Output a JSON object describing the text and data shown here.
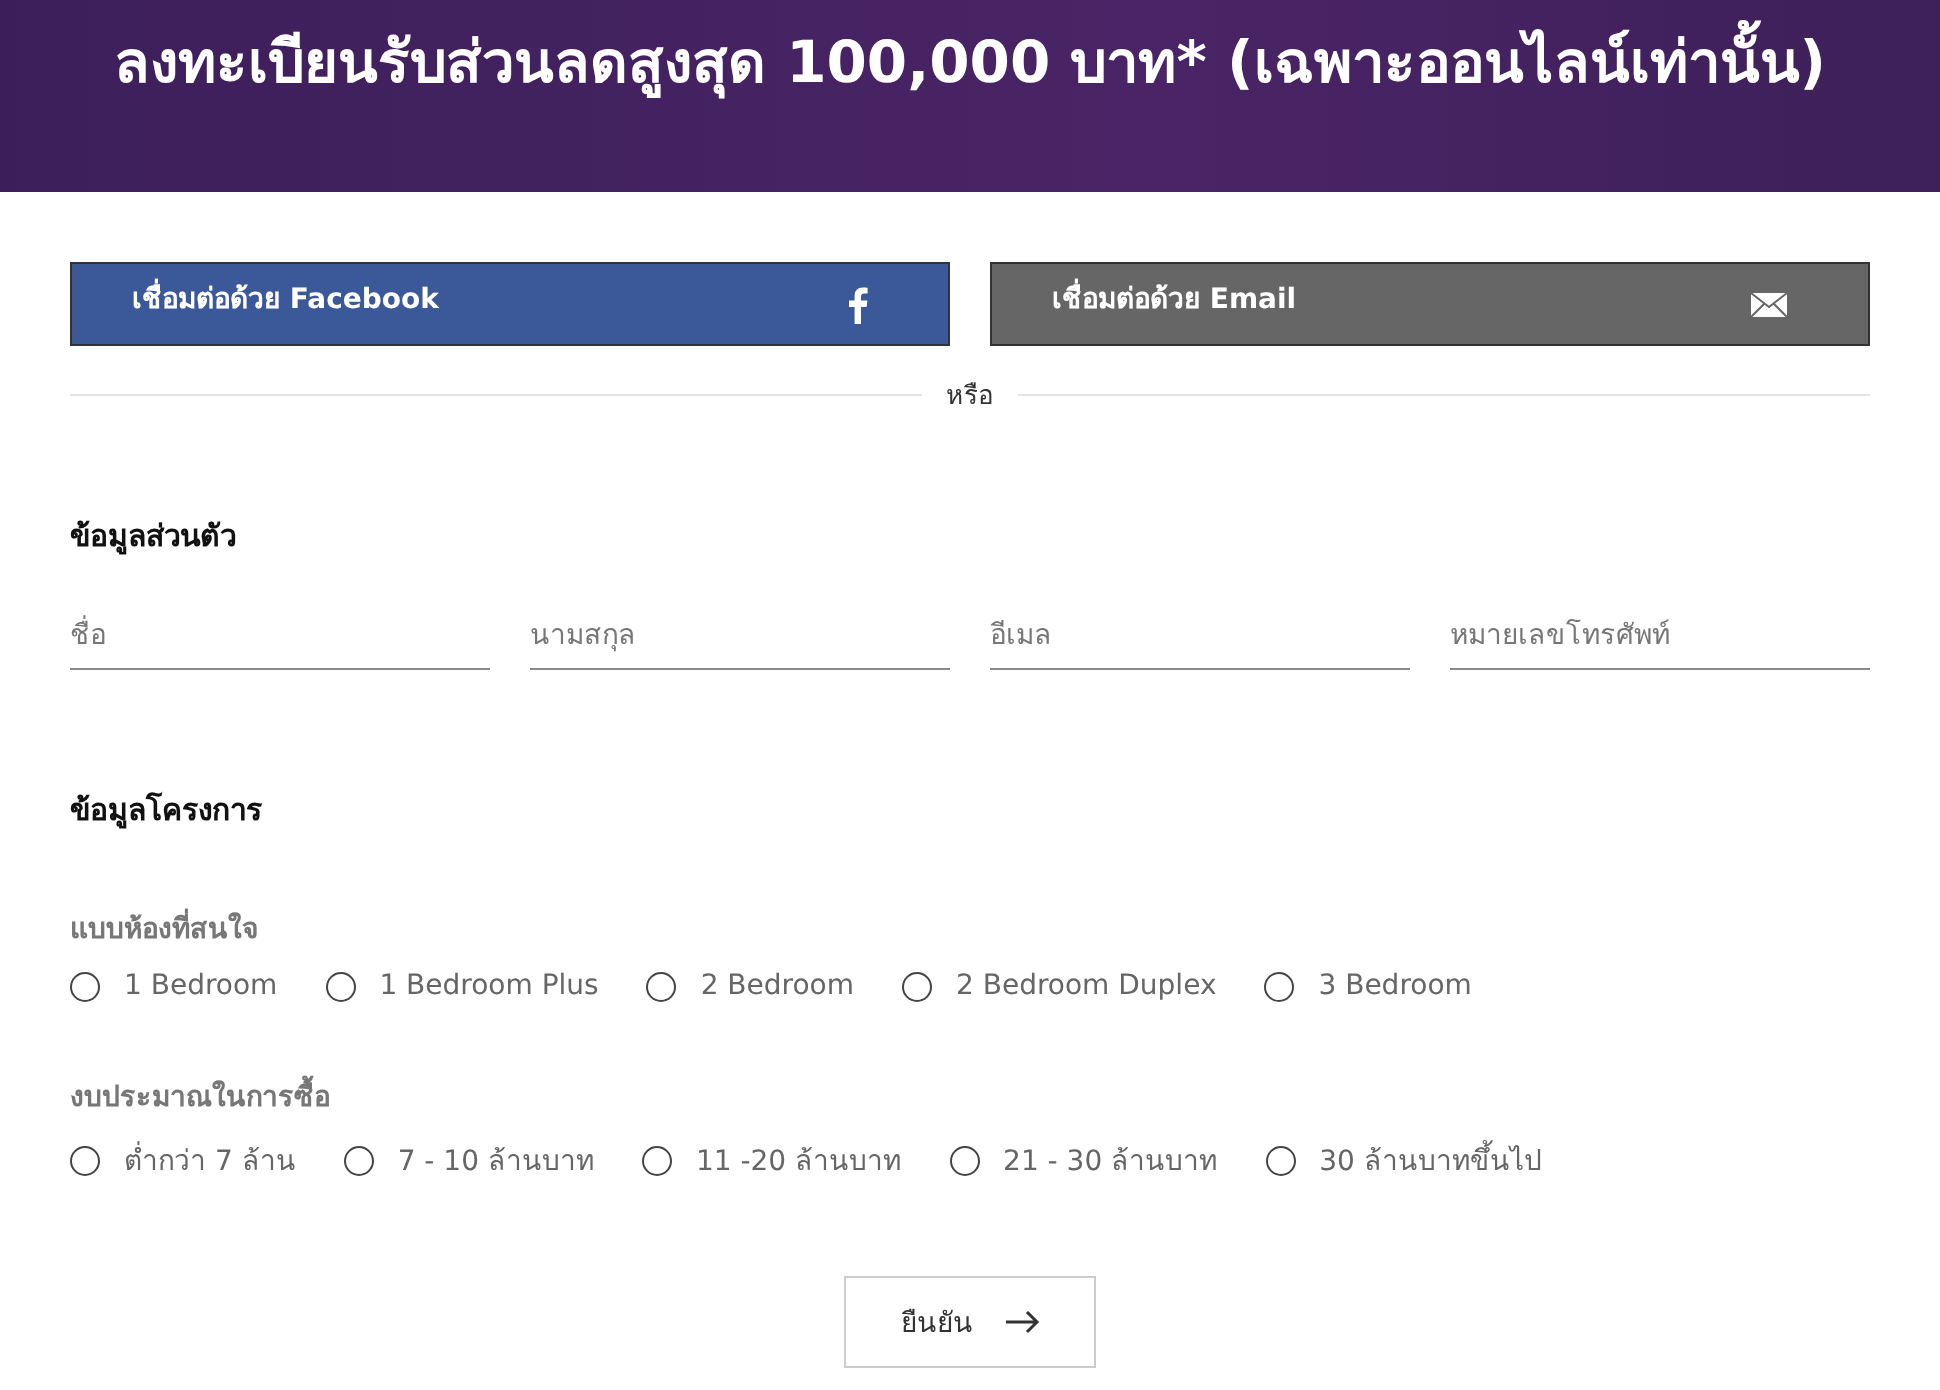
{
  "header": {
    "title": "ลงทะเบียนรับส่วนลดสูงสุด 100,000 บาท* (เฉพาะออนไลน์เท่านั้น)"
  },
  "social_buttons": [
    {
      "kind": "facebook",
      "label": "เชื่อมต่อด้วย Facebook"
    },
    {
      "kind": "email",
      "label": "เชื่อมต่อด้วย Email"
    }
  ],
  "divider": {
    "label": "หรือ"
  },
  "personal": {
    "heading": "ข้อมูลส่วนตัว",
    "fields": [
      {
        "placeholder": "ชื่อ"
      },
      {
        "placeholder": "นามสกุล"
      },
      {
        "placeholder": "อีเมล"
      },
      {
        "placeholder": "หมายเลขโทรศัพท์"
      }
    ]
  },
  "project": {
    "heading": "ข้อมูลโครงการ",
    "groups": [
      {
        "label": "แบบห้องที่สนใจ",
        "options": [
          {
            "label": "1 Bedroom",
            "selected": false
          },
          {
            "label": "1 Bedroom Plus",
            "selected": false
          },
          {
            "label": "2 Bedroom",
            "selected": false
          },
          {
            "label": "2 Bedroom Duplex",
            "selected": false
          },
          {
            "label": "3 Bedroom",
            "selected": false
          }
        ]
      },
      {
        "label": "งบประมาณในการซื้อ",
        "options": [
          {
            "label": "ต่ำกว่า 7 ล้าน",
            "selected": false
          },
          {
            "label": "7 - 10 ล้านบาท",
            "selected": false
          },
          {
            "label": "11 -20 ล้านบาท",
            "selected": false
          },
          {
            "label": "21 - 30 ล้านบาท",
            "selected": false
          },
          {
            "label": "30 ล้านบาทขึ้นไป",
            "selected": false
          }
        ]
      }
    ]
  },
  "submit": {
    "label": "ยืนยัน"
  }
}
